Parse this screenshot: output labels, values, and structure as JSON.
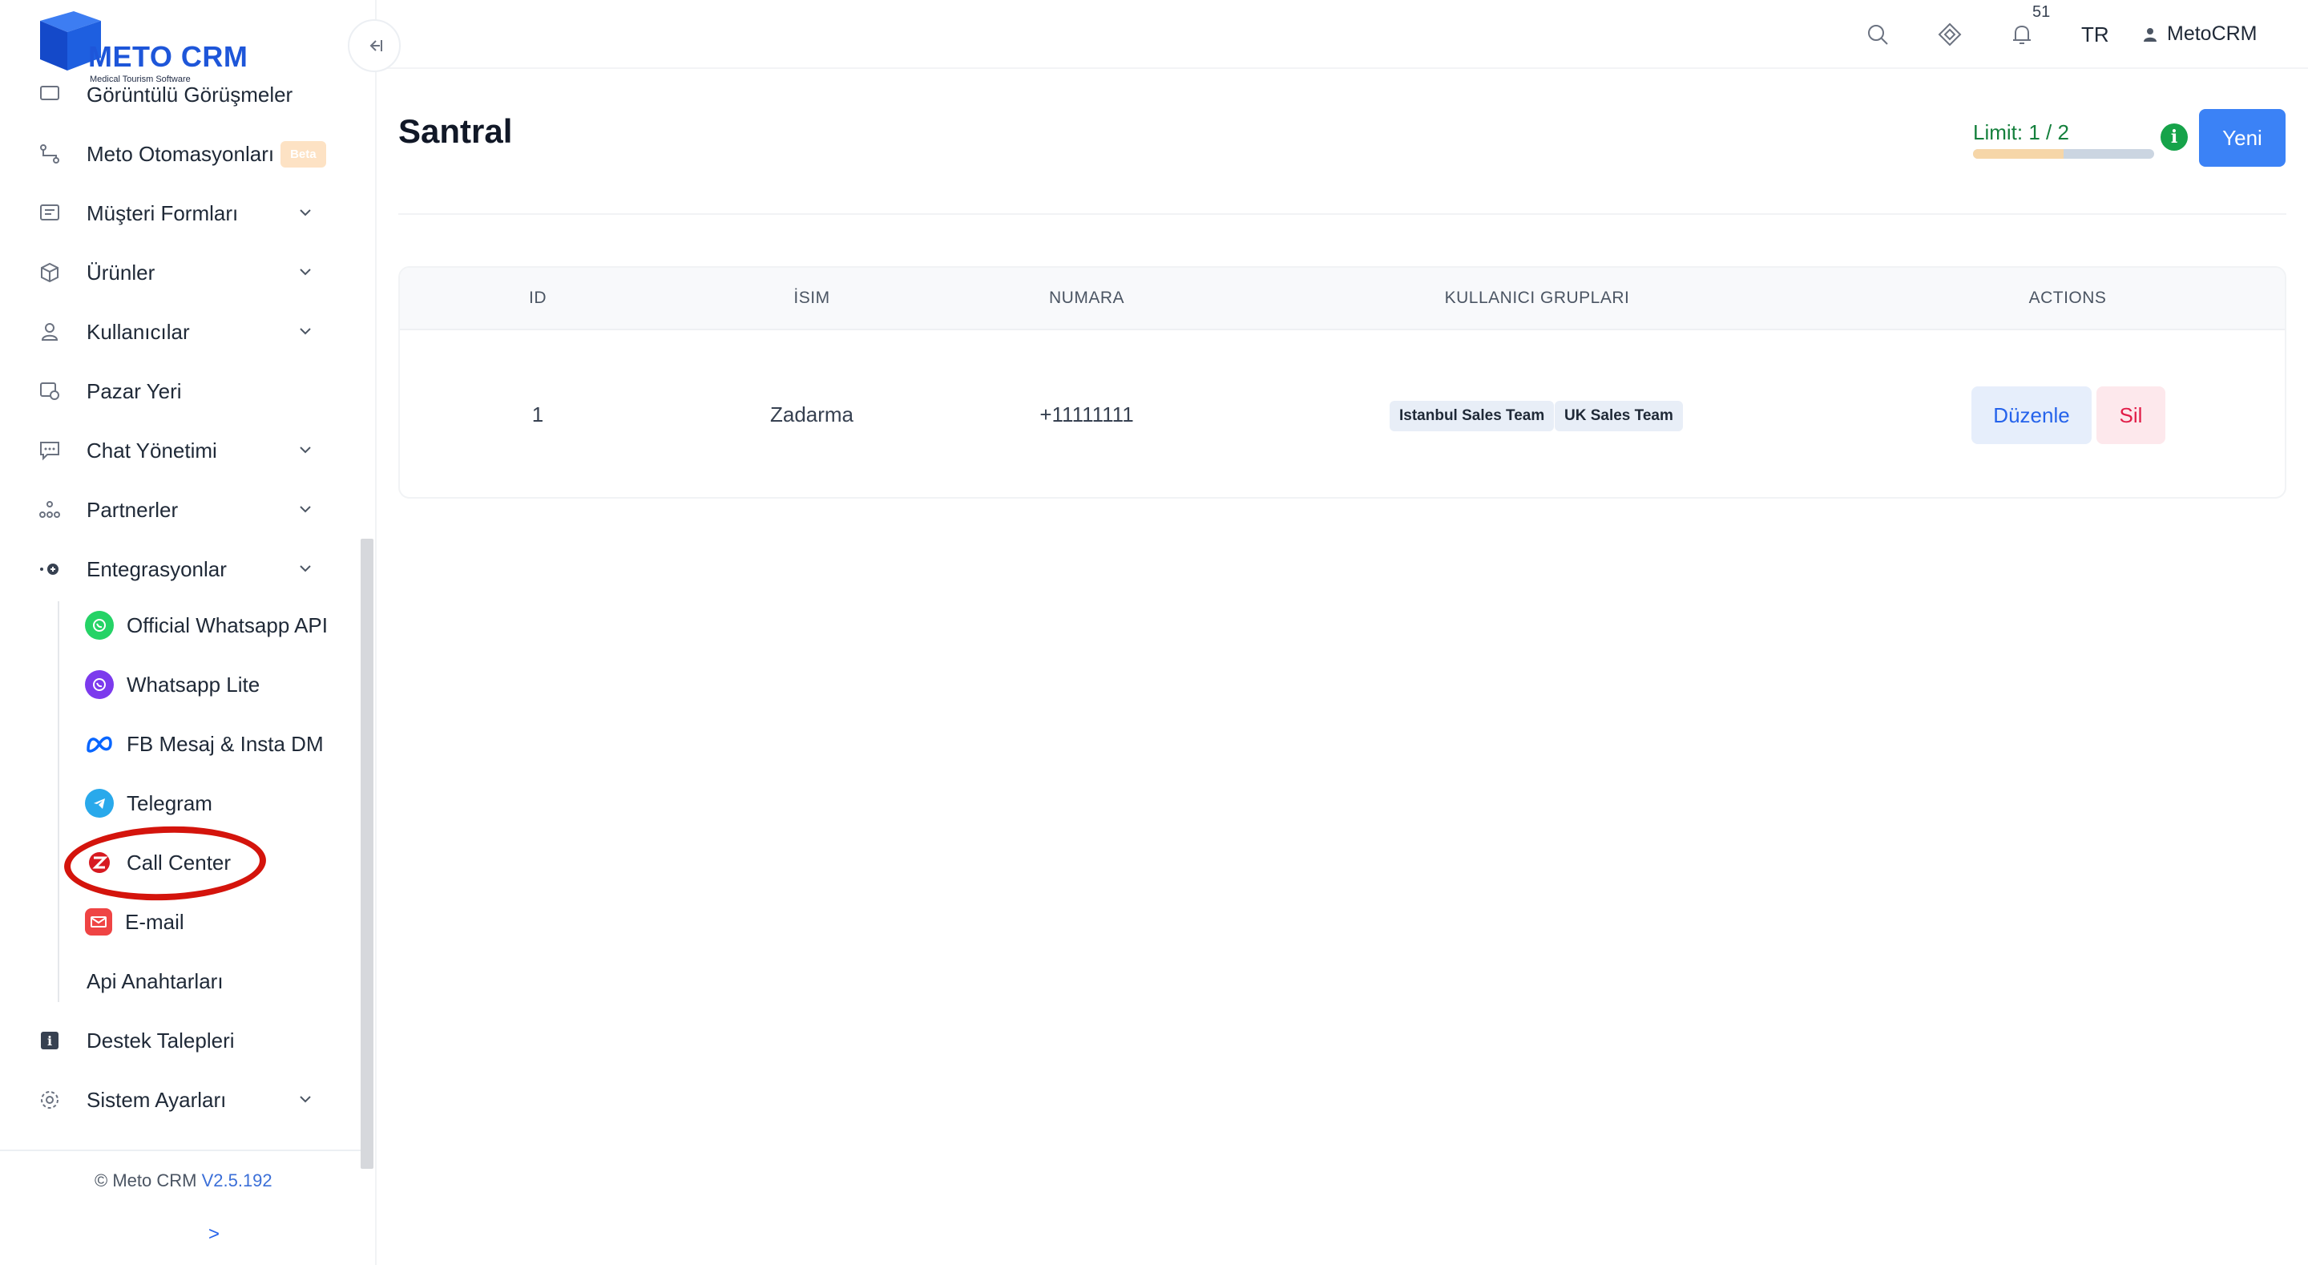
{
  "app": {
    "brand": "METO CRM",
    "tagline": "Medical Tourism Software",
    "version_prefix": "© Meto CRM",
    "version": "V2.5.192",
    "expand_label": ">"
  },
  "sidebar": {
    "items": [
      {
        "label": "Görüntülü Görüşmeler",
        "icon": "video-call-icon"
      },
      {
        "label": "Meto Otomasyonları",
        "icon": "automation-icon",
        "badge": "Beta"
      },
      {
        "label": "Müşteri Formları",
        "icon": "form-icon",
        "expandable": true
      },
      {
        "label": "Ürünler",
        "icon": "box-icon",
        "expandable": true
      },
      {
        "label": "Kullanıcılar",
        "icon": "user-icon",
        "expandable": true
      },
      {
        "label": "Pazar Yeri",
        "icon": "marketplace-icon"
      },
      {
        "label": "Chat Yönetimi",
        "icon": "chat-icon",
        "expandable": true
      },
      {
        "label": "Partnerler",
        "icon": "partners-icon",
        "expandable": true
      },
      {
        "label": "Entegrasyonlar",
        "icon": "integration-icon",
        "expandable": true,
        "expanded": true
      },
      {
        "label": "Destek Talepleri",
        "icon": "support-icon"
      },
      {
        "label": "Sistem Ayarları",
        "icon": "settings-icon",
        "expandable": true
      }
    ],
    "integration_items": [
      {
        "label": "Official Whatsapp API",
        "icon": "whatsapp-icon",
        "color": "#25d366"
      },
      {
        "label": "Whatsapp Lite",
        "icon": "whatsapp-lite-icon",
        "color": "#7c3aed"
      },
      {
        "label": "FB Mesaj & Insta DM",
        "icon": "meta-icon",
        "color": "#0866ff"
      },
      {
        "label": "Telegram",
        "icon": "telegram-icon",
        "color": "#29a9eb"
      },
      {
        "label": "Call Center",
        "icon": "zadarma-icon",
        "color": "#d71920"
      },
      {
        "label": "E-mail",
        "icon": "email-icon",
        "color": "#ef4444"
      },
      {
        "label": "Api Anahtarları",
        "icon": ""
      }
    ]
  },
  "topbar": {
    "notification_count": "51",
    "language": "TR",
    "user_name": "MetoCRM"
  },
  "page": {
    "title": "Santral",
    "limit_label": "Limit: 1 / 2",
    "limit_fraction": 0.5,
    "new_button": "Yeni"
  },
  "table": {
    "headers": [
      "ID",
      "İSIM",
      "NUMARA",
      "KULLANICI GRUPLARI",
      "ACTIONS"
    ],
    "rows": [
      {
        "id": "1",
        "name": "Zadarma",
        "number": "+11111111",
        "groups": [
          "Istanbul Sales Team",
          "UK Sales Team"
        ],
        "edit": "Düzenle",
        "delete": "Sil"
      }
    ]
  },
  "colors": {
    "accent": "#3b82f6",
    "brand": "#1e56d9",
    "limit_text": "#15803d",
    "annotation": "#d4140c"
  }
}
